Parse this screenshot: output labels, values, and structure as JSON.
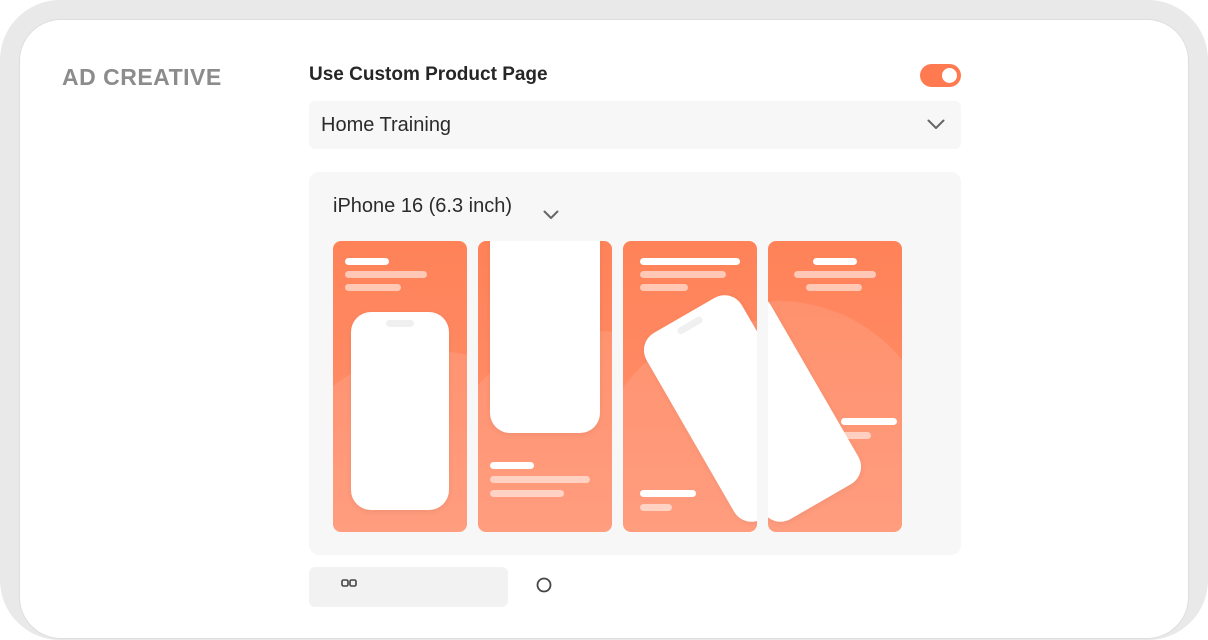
{
  "section": {
    "title": "AD CREATIVE"
  },
  "custom_product_page": {
    "label": "Use Custom Product Page",
    "enabled": true,
    "selected_value": "Home Training"
  },
  "preview": {
    "device": "iPhone 16 (6.3 inch)",
    "screenshot_count": 4
  },
  "bottom_actions": {
    "left_label": "",
    "right_label": ""
  },
  "colors": {
    "accent": "#ff7a50",
    "screenshot_bg": "#ff8258",
    "panel_bg": "#f7f7f7",
    "label_gray": "#8c8c8c"
  },
  "icons": {
    "select_chevron": "chevron-down-icon",
    "device_chevron": "chevron-down-icon"
  }
}
